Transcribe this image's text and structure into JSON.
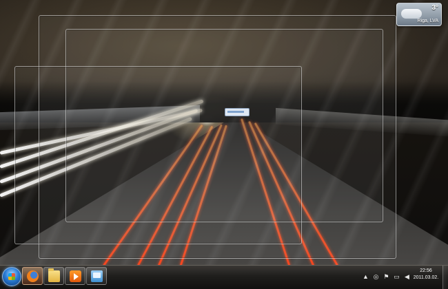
{
  "weather": {
    "temperature": "3°",
    "location": "Riga, LVA",
    "icon": "cloud-icon"
  },
  "taskbar": {
    "start_icon": "windows-start-orb",
    "pinned": [
      {
        "name": "firefox",
        "icon": "firefox-icon",
        "active": true
      },
      {
        "name": "windows-explorer",
        "icon": "folder-icon",
        "active": false
      },
      {
        "name": "media-player",
        "icon": "media-player-icon",
        "active": false
      },
      {
        "name": "remote-desktop",
        "icon": "remote-desktop-icon",
        "active": false
      }
    ],
    "tray_icons": [
      "show-hidden-icons-arrow",
      "network-icon",
      "action-center-icon",
      "display-icon",
      "volume-icon"
    ],
    "clock": {
      "time": "22:56",
      "date": "2011.03.02."
    }
  }
}
